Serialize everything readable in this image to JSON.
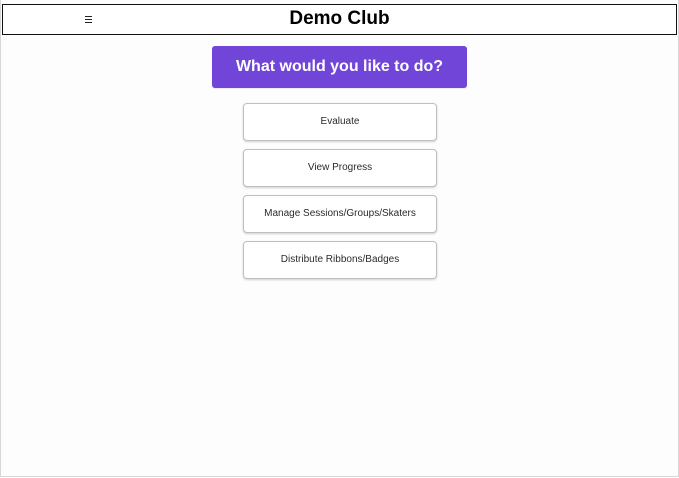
{
  "header": {
    "title": "Demo Club",
    "menu_icon": "hamburger-menu-icon"
  },
  "main": {
    "prompt": "What would you like to do?",
    "actions": [
      {
        "label": "Evaluate"
      },
      {
        "label": "View Progress"
      },
      {
        "label": "Manage Sessions/Groups/Skaters"
      },
      {
        "label": "Distribute Ribbons/Badges"
      }
    ]
  },
  "colors": {
    "accent": "#7145d8",
    "button_border": "#bfbfbf",
    "text": "#2b2b2b"
  }
}
